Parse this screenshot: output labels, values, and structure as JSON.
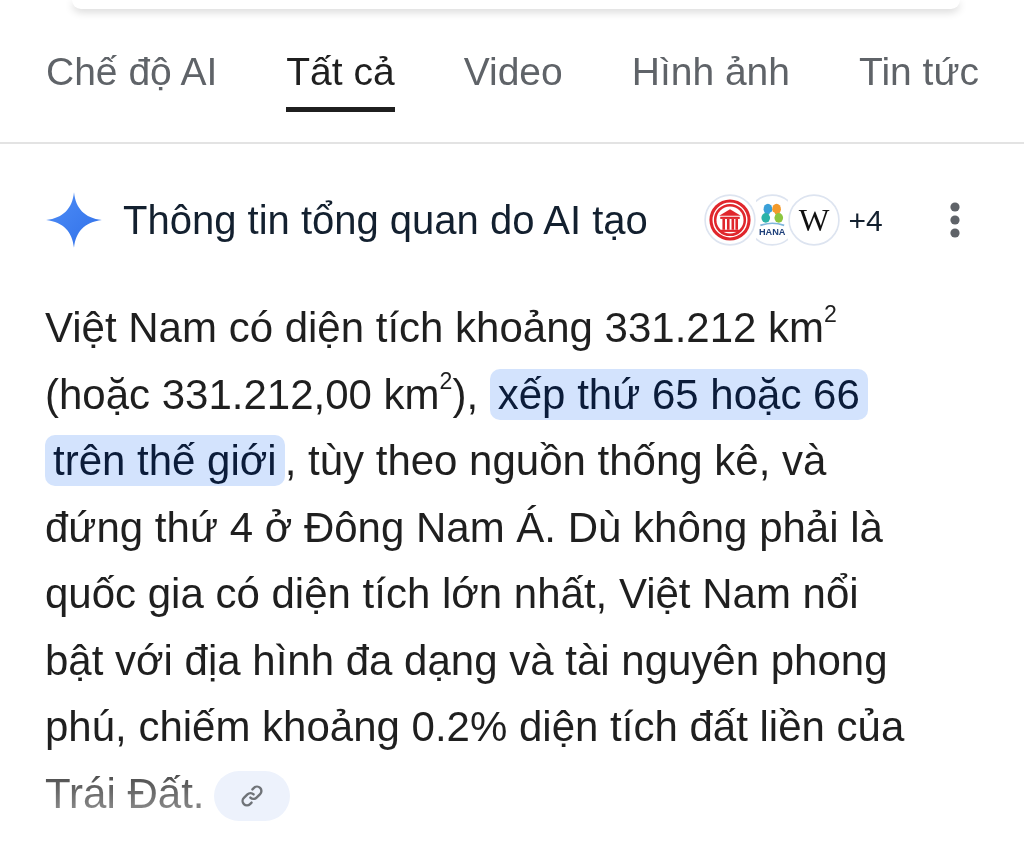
{
  "tabs": [
    {
      "label": "Chế độ AI",
      "selected": false
    },
    {
      "label": "Tất cả",
      "selected": true
    },
    {
      "label": "Video",
      "selected": false
    },
    {
      "label": "Hình ảnh",
      "selected": false
    },
    {
      "label": "Tin tức",
      "selected": false
    }
  ],
  "ai_overview": {
    "title": "Thông tin tổng quan do AI tạo",
    "sources": [
      {
        "kind": "seal"
      },
      {
        "kind": "flower",
        "logo_text": "HANA"
      },
      {
        "kind": "letter",
        "logo_text": "W"
      }
    ],
    "more_sources": "+4",
    "collapsed": true,
    "segments": [
      {
        "text": "Việt Nam có diện tích khoảng 331.212 km$^{2}$ (hoặc 331.212,00 km$^{2}$), ",
        "highlighted": false
      },
      {
        "text": "xếp thứ 65 hoặc 66 trên thế giới",
        "highlighted": true
      },
      {
        "text": ", tùy theo nguồn thống kê, và đứng thứ 4 ở Đông Nam Á. Dù không phải là quốc gia có diện tích lớn nhất, Việt Nam nổi bật với địa hình đa dạng và tài nguyên phong phú, chiếm khoảng 0.2% diện tích đất liền của Trái Đất.",
        "highlighted": false
      }
    ]
  }
}
